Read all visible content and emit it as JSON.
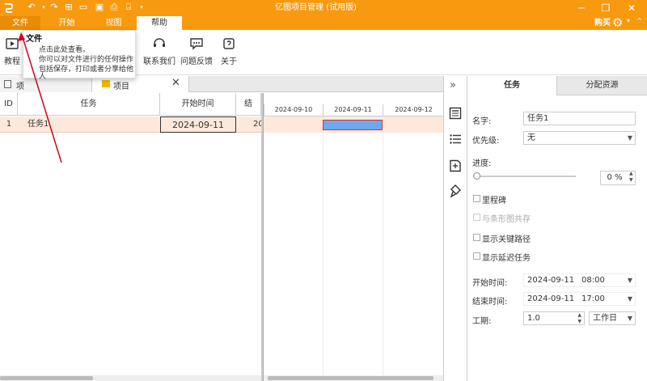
{
  "app": {
    "title": "亿图项目管理 (试用版)",
    "buy_label": "购买"
  },
  "menu": {
    "tabs": [
      "文件",
      "开始",
      "视图",
      "帮助"
    ],
    "active": "帮助"
  },
  "ribbon": {
    "buttons": [
      {
        "name": "tutorial",
        "label": "教程"
      },
      {
        "name": "contact",
        "label": "联系我们"
      },
      {
        "name": "feedback",
        "label": "问题反馈"
      },
      {
        "name": "about",
        "label": "关于"
      }
    ]
  },
  "tooltip": {
    "title": "文件",
    "lines": [
      "点击此处查看。",
      "你可以对文件进行的任何操作",
      "包括保存，打印或者分享给他",
      "人"
    ]
  },
  "doc_tabs": [
    "项",
    "项目"
  ],
  "grid": {
    "columns": [
      "ID",
      "任务",
      "开始时间",
      "结"
    ],
    "rows": [
      {
        "id": "1",
        "task": "任务1",
        "start": "2024-09-11",
        "end": "20"
      }
    ]
  },
  "gantt": {
    "dates": [
      "2024-09-10",
      "2024-09-11",
      "2024-09-12"
    ]
  },
  "colors": {
    "brand": "#f79a10",
    "row_highlight": "#fde9dc",
    "bar": "#6fa8ec",
    "bar_border": "#d9342b",
    "arrow": "#d0021b"
  },
  "props": {
    "tabs": [
      "任务",
      "分配资源"
    ],
    "name_label": "名字:",
    "name_value": "任务1",
    "priority_label": "优先级:",
    "priority_value": "无",
    "progress_label": "进度:",
    "progress_value": "0 %",
    "progress_fraction": 0,
    "milestone_label": "里程碑",
    "coexist_label": "与条形图共存",
    "critical_label": "显示关键路径",
    "delay_label": "显示延迟任务",
    "start_label": "开始时间:",
    "start_date": "2024-09-11",
    "start_time": "08:00",
    "end_label": "结束时间:",
    "end_date": "2024-09-11",
    "end_time": "17:00",
    "duration_label": "工期:",
    "duration_value": "1.0",
    "duration_unit": "工作日"
  }
}
